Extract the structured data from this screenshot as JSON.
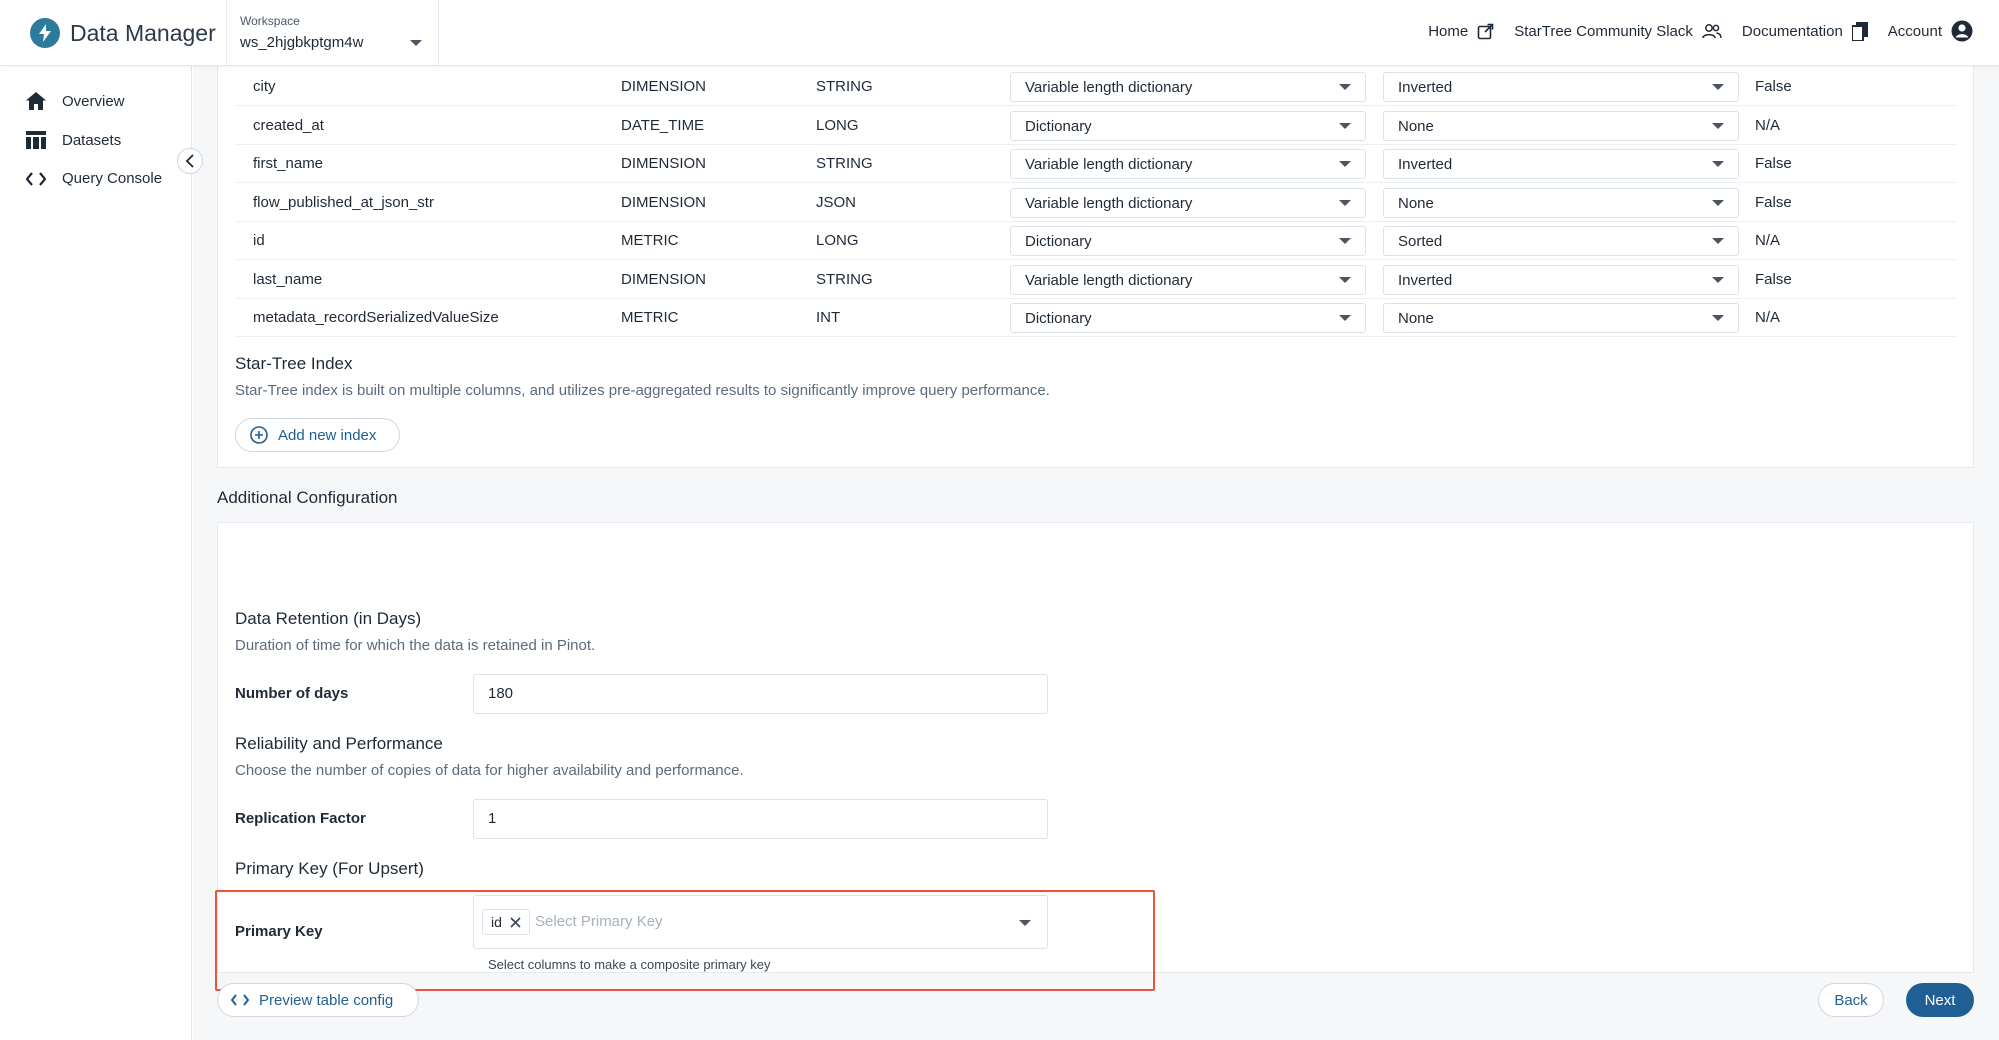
{
  "brand": {
    "name": "Data Manager"
  },
  "workspace": {
    "label": "Workspace",
    "value": "ws_2hjgbkptgm4w"
  },
  "topnav": {
    "home": "Home",
    "slack": "StarTree Community Slack",
    "docs": "Documentation",
    "account": "Account"
  },
  "sidebar": {
    "items": [
      {
        "label": "Overview",
        "icon": "home-icon"
      },
      {
        "label": "Datasets",
        "icon": "table-icon"
      },
      {
        "label": "Query Console",
        "icon": "code-icon"
      }
    ]
  },
  "index_table": {
    "rows": [
      {
        "name": "city",
        "field_type": "DIMENSION",
        "data_type": "STRING",
        "encoding": "Variable length dictionary",
        "index": "Inverted",
        "flag": "False"
      },
      {
        "name": "created_at",
        "field_type": "DATE_TIME",
        "data_type": "LONG",
        "encoding": "Dictionary",
        "index": "None",
        "flag": "N/A"
      },
      {
        "name": "first_name",
        "field_type": "DIMENSION",
        "data_type": "STRING",
        "encoding": "Variable length dictionary",
        "index": "Inverted",
        "flag": "False"
      },
      {
        "name": "flow_published_at_json_str",
        "field_type": "DIMENSION",
        "data_type": "JSON",
        "encoding": "Variable length dictionary",
        "index": "None",
        "flag": "False"
      },
      {
        "name": "id",
        "field_type": "METRIC",
        "data_type": "LONG",
        "encoding": "Dictionary",
        "index": "Sorted",
        "flag": "N/A"
      },
      {
        "name": "last_name",
        "field_type": "DIMENSION",
        "data_type": "STRING",
        "encoding": "Variable length dictionary",
        "index": "Inverted",
        "flag": "False"
      },
      {
        "name": "metadata_recordSerializedValueSize",
        "field_type": "METRIC",
        "data_type": "INT",
        "encoding": "Dictionary",
        "index": "None",
        "flag": "N/A"
      }
    ]
  },
  "star_tree": {
    "title": "Star-Tree Index",
    "description": "Star-Tree index is built on multiple columns, and utilizes pre-aggregated results to significantly improve query performance.",
    "add_button": "Add new index"
  },
  "additional": {
    "title": "Additional Configuration",
    "retention": {
      "title": "Data Retention (in Days)",
      "description": "Duration of time for which the data is retained in Pinot.",
      "label": "Number of days",
      "value": "180"
    },
    "reliability": {
      "title": "Reliability and Performance",
      "description": "Choose the number of copies of data for higher availability and performance.",
      "label": "Replication Factor",
      "value": "1"
    },
    "primary_key": {
      "title": "Primary Key (For Upsert)",
      "label": "Primary Key",
      "chip": "id",
      "placeholder": "Select Primary Key",
      "help": "Select columns to make a composite primary key"
    }
  },
  "footer": {
    "preview": "Preview table config",
    "back": "Back",
    "next": "Next"
  },
  "colors": {
    "accent": "#1f5f94",
    "highlight": "#e8553b",
    "brand": "#2c7a9c"
  }
}
